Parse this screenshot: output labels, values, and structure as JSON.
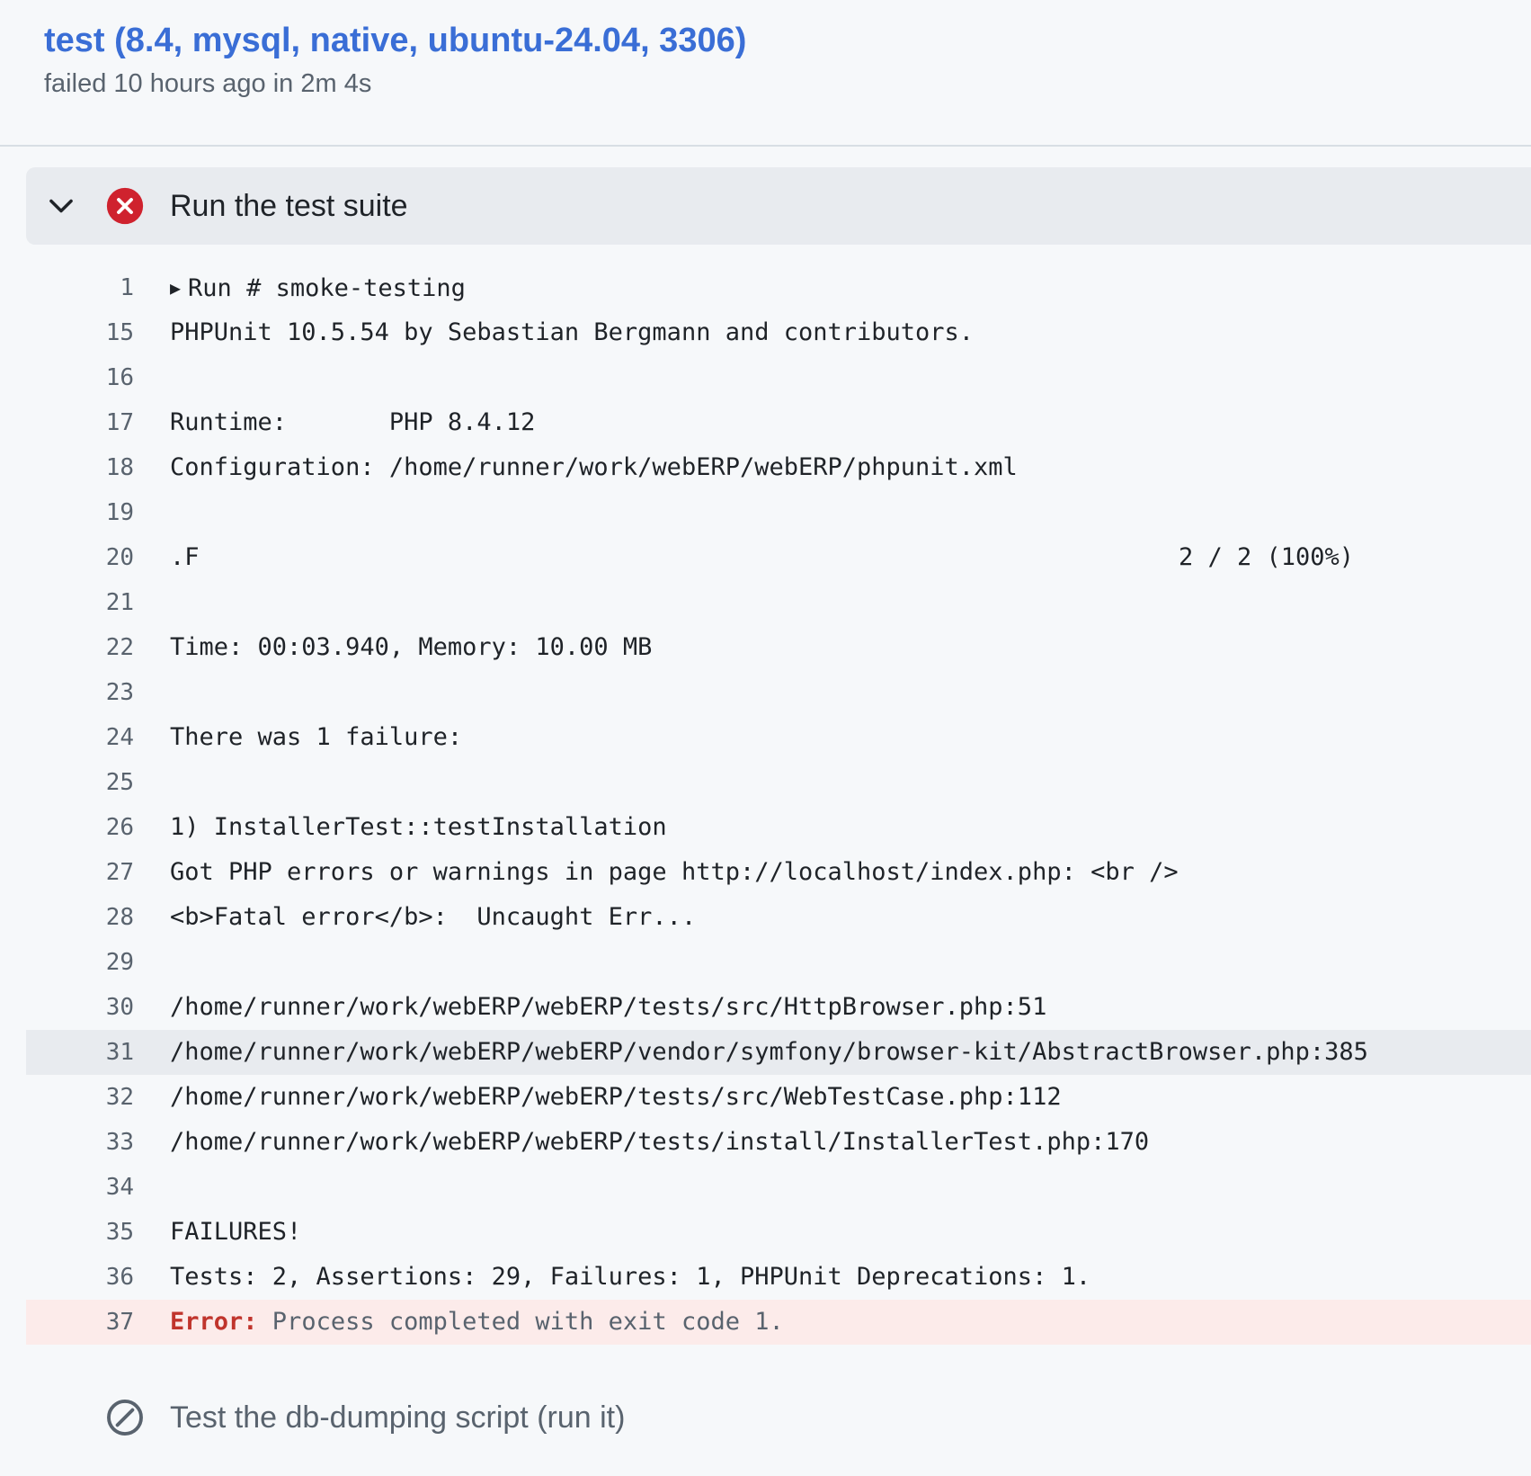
{
  "job": {
    "title": "test (8.4, mysql, native, ubuntu-24.04, 3306)",
    "subtitle": "failed 10 hours ago in 2m 4s"
  },
  "step": {
    "title": "Run the test suite",
    "status": "failed",
    "expanded": true,
    "chevron_icon": "chevron-down-icon",
    "status_icon": "x-circle-fill-icon",
    "status_color": "#cf222e"
  },
  "log": {
    "lines": [
      {
        "n": "1",
        "text": "Run # smoke-testing",
        "expandable": true
      },
      {
        "n": "15",
        "text": "PHPUnit 10.5.54 by Sebastian Bergmann and contributors."
      },
      {
        "n": "16",
        "text": ""
      },
      {
        "n": "17",
        "text": "Runtime:       PHP 8.4.12"
      },
      {
        "n": "18",
        "text": "Configuration: /home/runner/work/webERP/webERP/phpunit.xml"
      },
      {
        "n": "19",
        "text": ""
      },
      {
        "n": "20",
        "text": ".F",
        "right": "2 / 2 (100%)"
      },
      {
        "n": "21",
        "text": ""
      },
      {
        "n": "22",
        "text": "Time: 00:03.940, Memory: 10.00 MB"
      },
      {
        "n": "23",
        "text": ""
      },
      {
        "n": "24",
        "text": "There was 1 failure:"
      },
      {
        "n": "25",
        "text": ""
      },
      {
        "n": "26",
        "text": "1) InstallerTest::testInstallation"
      },
      {
        "n": "27",
        "text": "Got PHP errors or warnings in page http://localhost/index.php: <br />"
      },
      {
        "n": "28",
        "text": "<b>Fatal error</b>:  Uncaught Err..."
      },
      {
        "n": "29",
        "text": ""
      },
      {
        "n": "30",
        "text": "/home/runner/work/webERP/webERP/tests/src/HttpBrowser.php:51"
      },
      {
        "n": "31",
        "text": "/home/runner/work/webERP/webERP/vendor/symfony/browser-kit/AbstractBrowser.php:385",
        "highlight": true
      },
      {
        "n": "32",
        "text": "/home/runner/work/webERP/webERP/tests/src/WebTestCase.php:112"
      },
      {
        "n": "33",
        "text": "/home/runner/work/webERP/webERP/tests/install/InstallerTest.php:170"
      },
      {
        "n": "34",
        "text": ""
      },
      {
        "n": "35",
        "text": "FAILURES!"
      },
      {
        "n": "36",
        "text": "Tests: 2, Assertions: 29, Failures: 1, PHPUnit Deprecations: 1."
      },
      {
        "n": "37",
        "label": "Error:",
        "text": " Process completed with exit code 1.",
        "error": true
      }
    ],
    "error_color": "#c0342c",
    "error_bg": "#fcebea"
  },
  "next_step": {
    "title": "Test the db-dumping script (run it)",
    "status": "skipped",
    "status_icon": "skip-icon"
  }
}
